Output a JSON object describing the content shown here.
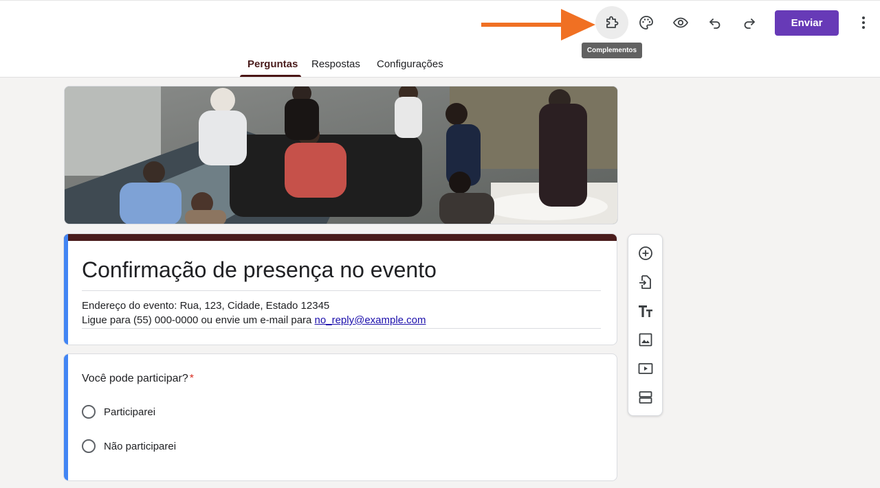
{
  "toolbar": {
    "buttons": [
      {
        "name": "addons-button",
        "icon": "puzzle-icon",
        "tooltip": "Complementos"
      },
      {
        "name": "theme-button",
        "icon": "palette-icon"
      },
      {
        "name": "preview-button",
        "icon": "eye-icon"
      },
      {
        "name": "undo-button",
        "icon": "undo-icon"
      },
      {
        "name": "redo-button",
        "icon": "redo-icon"
      },
      {
        "name": "more-button",
        "icon": "more-vert-icon"
      }
    ],
    "send_label": "Enviar",
    "tooltip": "Complementos"
  },
  "tabs": [
    {
      "label": "Perguntas",
      "active": true
    },
    {
      "label": "Respostas",
      "active": false
    },
    {
      "label": "Configurações",
      "active": false
    }
  ],
  "form": {
    "title": "Confirmação de presença no evento",
    "description_line1": "Endereço do evento: Rua, 123, Cidade, Estado 12345",
    "description_line2_prefix": "Ligue para (55) 000-0000 ou envie um e-mail para ",
    "description_email": "no_reply@example.com"
  },
  "question": {
    "title": "Você pode participar?",
    "required_mark": "*",
    "options": [
      "Participarei",
      "Não participarei"
    ]
  },
  "side_tools": [
    {
      "name": "add-question-button",
      "icon": "add-circle-icon"
    },
    {
      "name": "import-questions-button",
      "icon": "import-icon"
    },
    {
      "name": "add-title-button",
      "icon": "title-text-icon"
    },
    {
      "name": "add-image-button",
      "icon": "image-icon"
    },
    {
      "name": "add-video-button",
      "icon": "video-icon"
    },
    {
      "name": "add-section-button",
      "icon": "section-icon"
    }
  ],
  "colors": {
    "accent": "#673ab7",
    "theme": "#4a1c1c",
    "focus_bar": "#4285f4",
    "arrow": "#f07023",
    "required": "#d93025"
  }
}
